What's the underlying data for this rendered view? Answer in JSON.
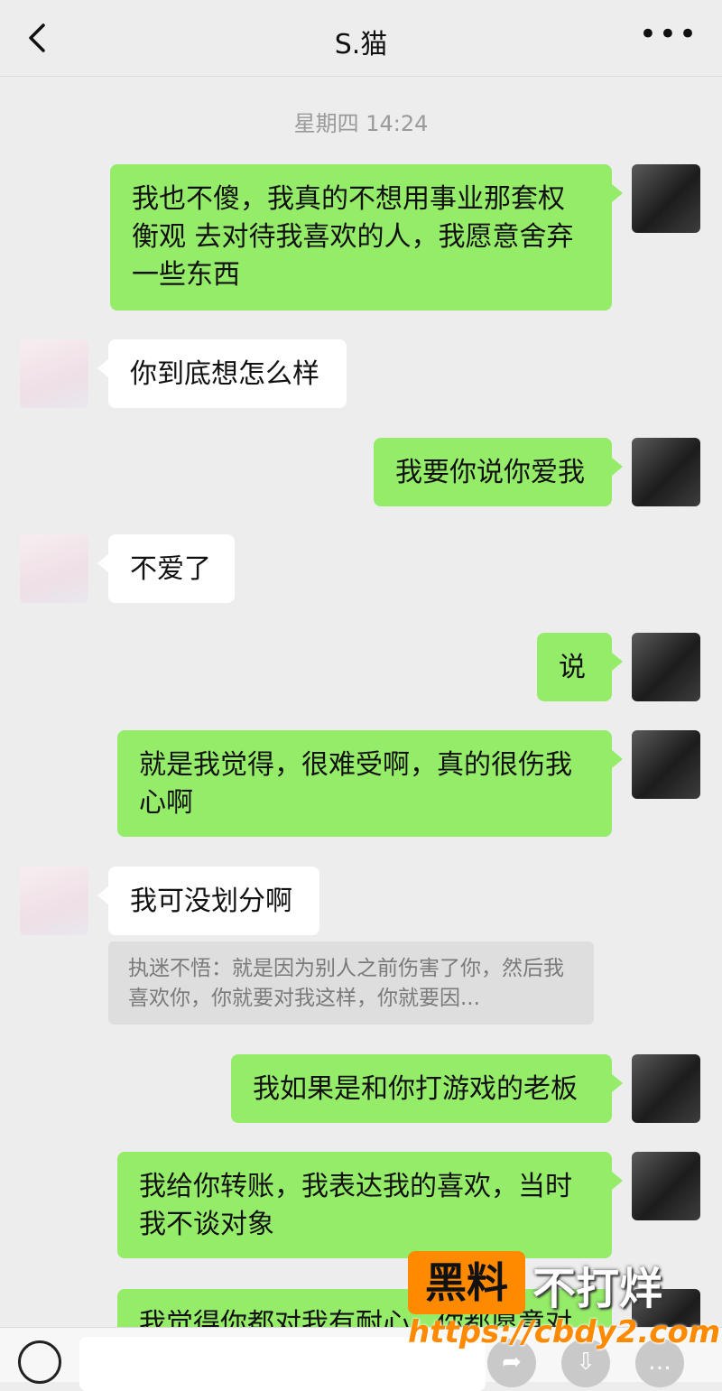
{
  "header": {
    "title": "S.猫",
    "more_glyph": "•••"
  },
  "timestamp": "星期四 14:24",
  "messages": [
    {
      "sender": "me",
      "text": "我也不傻，我真的不想用事业那套权衡观 去对待我喜欢的人，我愿意舍弃一些东西"
    },
    {
      "sender": "her",
      "text": "你到底想怎么样"
    },
    {
      "sender": "me",
      "text": "我要你说你爱我"
    },
    {
      "sender": "her",
      "text": "不爱了"
    },
    {
      "sender": "me",
      "text": "说"
    },
    {
      "sender": "me",
      "text": "就是我觉得，很难受啊，真的很伤我心啊"
    },
    {
      "sender": "her",
      "text": "我可没划分啊"
    },
    {
      "sender": "me",
      "text": "我如果是和你打游戏的老板"
    },
    {
      "sender": "me",
      "text": "我给你转账，我表达我的喜欢，当时我不谈对象"
    },
    {
      "sender": "me",
      "text": "我觉得你都对我有耐心，你都愿意对"
    }
  ],
  "quote": {
    "text": "执迷不悟：就是因为别人之前伤害了你，然后我喜欢你，你就要对我这样，你就要因..."
  },
  "watermark": {
    "brand": "黑料",
    "slogan": "不打烊",
    "url": "https://cbdy2.com"
  },
  "colors": {
    "my_bubble": "#95ec69",
    "her_bubble": "#ffffff",
    "background": "#ededed",
    "watermark_orange": "#ff8a00"
  },
  "icons": {
    "back": "chevron-left-icon",
    "more": "more-dots-icon",
    "voice": "voice-icon"
  }
}
